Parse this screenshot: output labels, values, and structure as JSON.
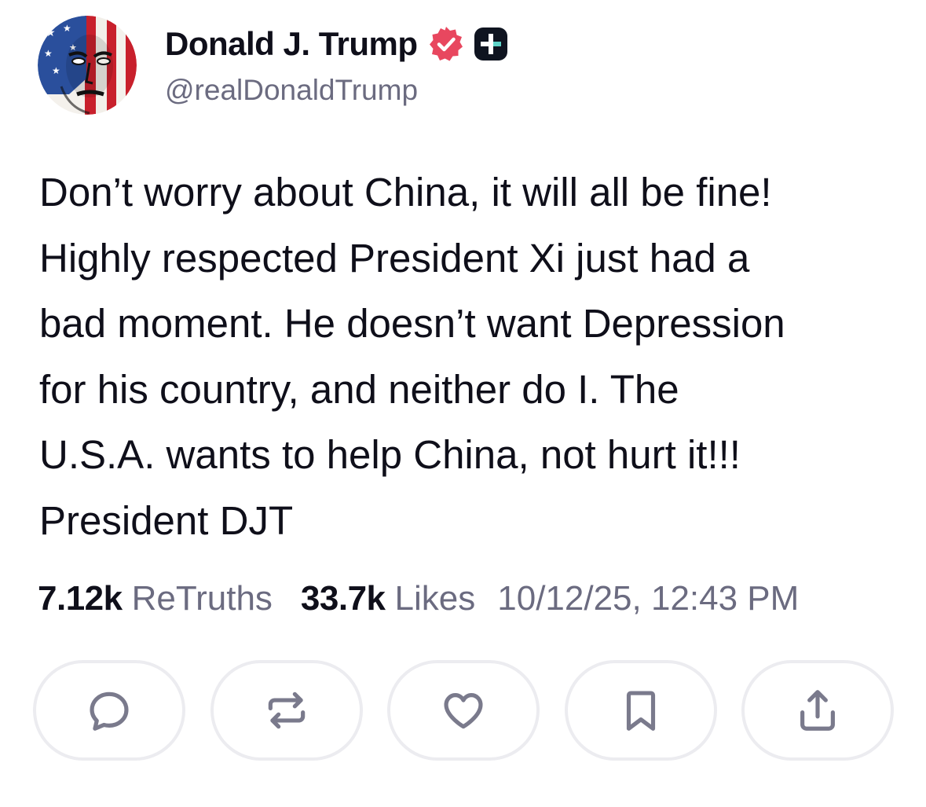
{
  "author": {
    "display_name": "Donald J. Trump",
    "handle": "@realDonaldTrump",
    "verified_badge": "verified-badge-icon",
    "plus_badge": "plus-badge-icon"
  },
  "post": {
    "lines": [
      "Don’t worry about China, it will all be fine!",
      "Highly respected President Xi just had a",
      "bad moment. He doesn’t want Depression",
      "for his country, and neither do I. The",
      "U.S.A. wants to help China, not hurt it!!!",
      "President DJT"
    ]
  },
  "stats": {
    "retruths_count": "7.12k",
    "retruths_label": "ReTruths",
    "likes_count": "33.7k",
    "likes_label": "Likes",
    "timestamp": "10/12/25, 12:43 PM"
  },
  "actions": [
    {
      "name": "reply-button",
      "icon": "comment-icon"
    },
    {
      "name": "retruth-button",
      "icon": "repost-icon"
    },
    {
      "name": "like-button",
      "icon": "heart-icon"
    },
    {
      "name": "bookmark-button",
      "icon": "bookmark-icon"
    },
    {
      "name": "share-button",
      "icon": "share-icon"
    }
  ],
  "colors": {
    "text": "#0f0f1a",
    "muted": "#6b6b80",
    "verified": "#e8475f",
    "button_border": "#ececf0",
    "icon": "#7a7a8c"
  }
}
